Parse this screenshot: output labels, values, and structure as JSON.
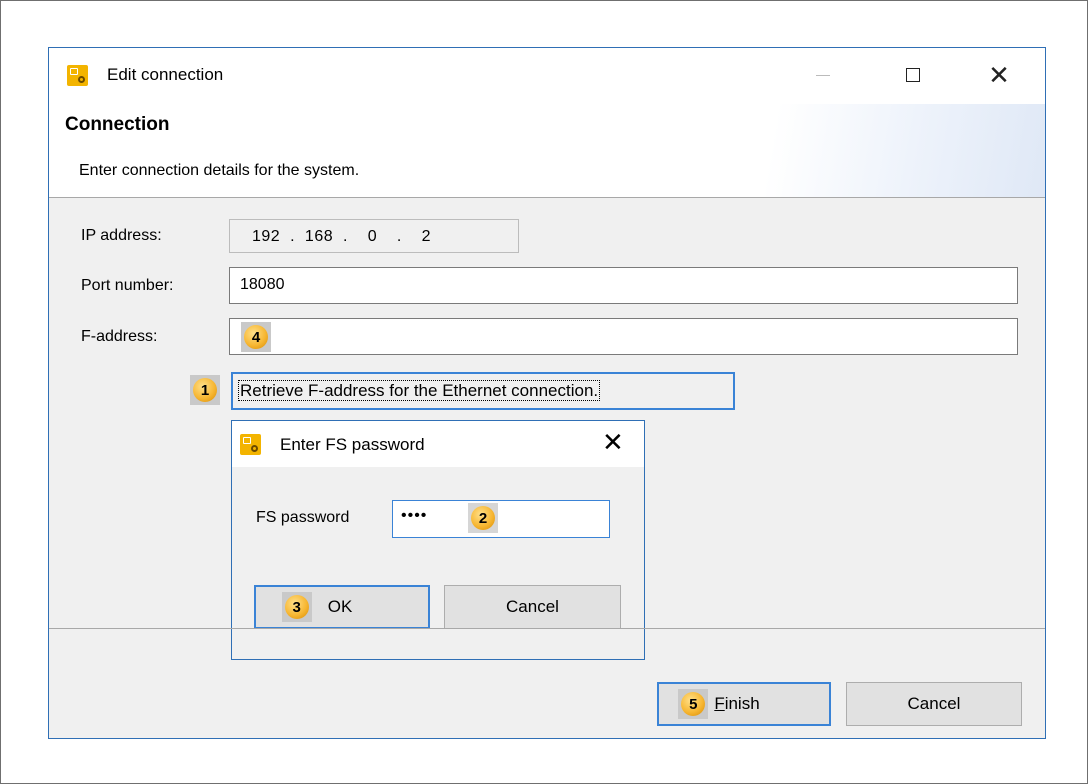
{
  "window": {
    "title": "Edit connection",
    "controls": {
      "minimize": "—",
      "maximize": "☐",
      "close": "✕"
    }
  },
  "banner": {
    "title": "Connection",
    "description": "Enter connection details for the system."
  },
  "form": {
    "ip_label": "IP address:",
    "ip_value": "192  .  168  .    0    .    2",
    "port_label": "Port number:",
    "port_value": "18080",
    "faddr_label": "F-address:",
    "faddr_value": ""
  },
  "retrieve_link": "Retrieve F-address for the Ethernet connection.",
  "password_dialog": {
    "title": "Enter FS password",
    "close": "✕",
    "password_label": "FS password",
    "password_value": "••••",
    "ok_label": "OK",
    "cancel_label": "Cancel"
  },
  "footer": {
    "finish_label": "Finish",
    "cancel_label": "Cancel"
  },
  "step_badges": {
    "retrieve": "1",
    "password": "2",
    "ok": "3",
    "faddress": "4",
    "finish": "5"
  },
  "colors": {
    "accent": "#3a83d6",
    "badge": "#f7b733",
    "app_icon": "#f3b400"
  }
}
